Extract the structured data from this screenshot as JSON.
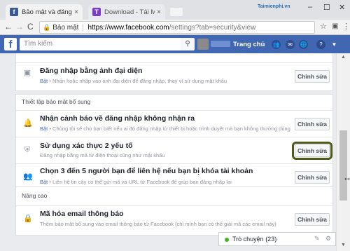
{
  "browser": {
    "tabs": [
      {
        "label": "Bảo mật và đăng nhập",
        "close": "×",
        "favicon": "f"
      },
      {
        "label": "Download - Tải Miễn Phí",
        "close": "×",
        "favicon": "T"
      }
    ],
    "watermark": "Taimienphi.vn",
    "window_controls": {
      "minimize": "–",
      "maximize": "☐",
      "close": "✕"
    },
    "nav": {
      "back": "←",
      "forward": "→",
      "reload": "C"
    },
    "address": {
      "security_label": "Bảo mật",
      "host": "https://www.facebook.com",
      "path": "/settings?tab=security&view"
    },
    "star": "☆"
  },
  "facebook": {
    "logo": "f",
    "search_placeholder": "Tìm kiếm",
    "home_label": "Trang chủ"
  },
  "sections": {
    "top_row": {
      "title": "Đăng nhập bằng ảnh đại diện",
      "status": "Bật",
      "desc": " • Nhấn hoặc nhập vào ảnh đại diện để đăng nhập, thay vì sử dụng mật khẩu",
      "button": "Chỉnh sửa"
    },
    "extra_security": {
      "title": "Thiết lập bảo mật bổ sung",
      "rows": [
        {
          "title": "Nhận cảnh báo về đăng nhập không nhận ra",
          "status": "Bật",
          "desc": " • Chúng tôi sẽ cho bạn biết nếu ai đó đăng nhập từ thiết bị hoặc trình duyệt mà bạn không thường dùng",
          "button": "Chỉnh sửa"
        },
        {
          "title": "Sử dụng xác thực 2 yếu tố",
          "status": "",
          "desc": "Đăng nhập bằng mã từ điện thoại cũng như mật khẩu",
          "button": "Chỉnh sửa"
        },
        {
          "title": "Chọn 3 đến 5 người bạn để liên hệ nếu bạn bị khóa tài khoản",
          "status": "Bật",
          "desc": " • Liên hệ tin cậy có thể gửi mã và URL từ Facebook để giúp bạn đăng nhập lại",
          "button": "Chỉnh sửa"
        }
      ]
    },
    "advanced": {
      "title": "Nâng cao",
      "rows": [
        {
          "title": "Mã hóa email thông báo",
          "desc": "Thêm bảo mật bổ sung vào email thông báo từ Facebook (chỉ mình bạn có thể giải mã các email này)",
          "button": "Chỉnh sửa"
        }
      ]
    }
  },
  "chat": {
    "label": "Trò chuyện (23)"
  },
  "colors": {
    "fb_blue": "#4267b2",
    "highlight_outline": "#4d5b16"
  },
  "icons": {
    "photo": "▣",
    "bell": "🔔",
    "shield": "⛨",
    "friends": "👥",
    "lock": "🔒"
  }
}
